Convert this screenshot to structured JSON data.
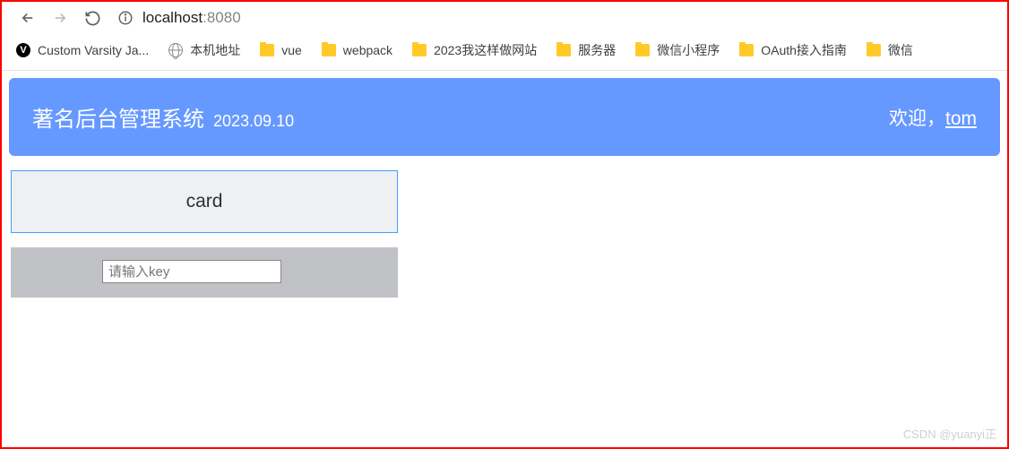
{
  "browser": {
    "url_host": "localhost",
    "url_port": ":8080"
  },
  "bookmarks": [
    {
      "icon": "v",
      "label": "Custom Varsity Ja..."
    },
    {
      "icon": "globe",
      "label": "本机地址"
    },
    {
      "icon": "folder",
      "label": "vue"
    },
    {
      "icon": "folder",
      "label": "webpack"
    },
    {
      "icon": "folder",
      "label": "2023我这样做网站"
    },
    {
      "icon": "folder",
      "label": "服务器"
    },
    {
      "icon": "folder",
      "label": "微信小程序"
    },
    {
      "icon": "folder",
      "label": "OAuth接入指南"
    },
    {
      "icon": "folder",
      "label": "微信"
    }
  ],
  "header": {
    "title": "著名后台管理系统",
    "date": "2023.09.10",
    "welcome": "欢迎，",
    "user": "tom"
  },
  "card": {
    "label": "card"
  },
  "input": {
    "placeholder": "请输入key"
  },
  "watermark": "CSDN @yuanyi正"
}
